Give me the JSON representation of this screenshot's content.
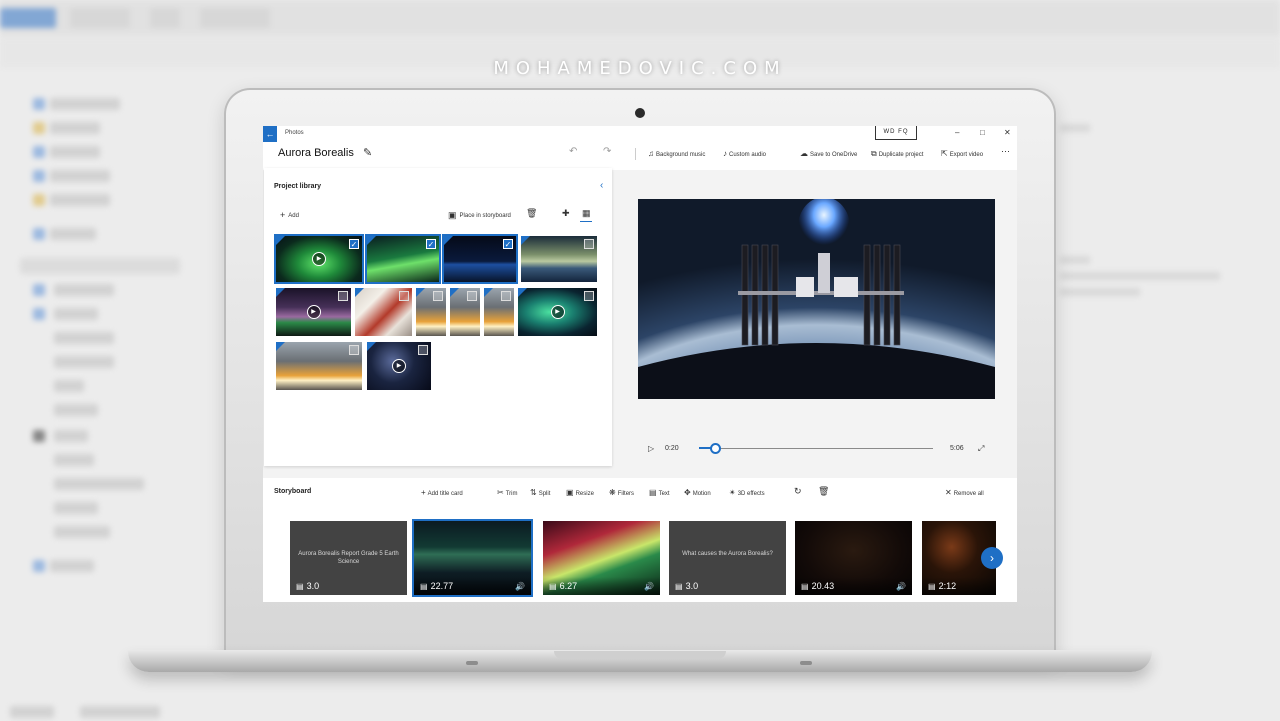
{
  "watermark": "MOHAMEDOVIC.COM",
  "window": {
    "app_name": "Photos",
    "badge": "WD FQ",
    "controls": {
      "minimize": "–",
      "maximize": "□",
      "close": "✕"
    }
  },
  "project": {
    "title": "Aurora Borealis"
  },
  "commands": {
    "background_music": "Background music",
    "custom_audio": "Custom audio",
    "save_onedrive": "Save to OneDrive",
    "duplicate_project": "Duplicate project",
    "export_video": "Export video"
  },
  "library": {
    "title": "Project library",
    "add": "Add",
    "place_in_storyboard": "Place in storyboard",
    "items": [
      {
        "theme": "aurora-green",
        "video": true,
        "selected": true
      },
      {
        "theme": "aurora-green2",
        "video": false,
        "selected": true
      },
      {
        "theme": "earth-night",
        "video": false,
        "selected": true
      },
      {
        "theme": "aurora-horizon",
        "video": false,
        "selected": false
      },
      {
        "theme": "aurora-purple",
        "video": true,
        "selected": false
      },
      {
        "theme": "interior",
        "video": false,
        "selected": false
      },
      {
        "theme": "launch",
        "video": false,
        "selected": false
      },
      {
        "theme": "launch",
        "video": false,
        "selected": false
      },
      {
        "theme": "launch",
        "video": false,
        "selected": false
      },
      {
        "theme": "aurora-teal",
        "video": true,
        "selected": false
      },
      {
        "theme": "launch",
        "video": false,
        "selected": false
      },
      {
        "theme": "stars-blue",
        "video": true,
        "selected": false
      }
    ]
  },
  "player": {
    "current_time": "0:20",
    "total_time": "5:06",
    "progress": 0.07
  },
  "storyboard": {
    "title": "Storyboard",
    "tools": {
      "add_title_card": "Add title card",
      "trim": "Trim",
      "split": "Split",
      "resize": "Resize",
      "filters": "Filters",
      "text": "Text",
      "motion": "Motion",
      "effects_3d": "3D effects",
      "remove_all": "Remove all"
    },
    "clips": [
      {
        "type": "card",
        "text": "Aurora Borealis Report Grade 5 Earth Science",
        "duration": "3.0",
        "audio": false,
        "selected": false
      },
      {
        "type": "video",
        "theme": "c-aurora-night",
        "duration": "22.77",
        "audio": true,
        "selected": true
      },
      {
        "type": "video",
        "theme": "c-aurora-red",
        "duration": "6.27",
        "audio": true,
        "selected": false
      },
      {
        "type": "card",
        "text": "What causes the Aurora Borealis?",
        "duration": "3.0",
        "audio": false,
        "selected": false
      },
      {
        "type": "video",
        "theme": "c-dark",
        "duration": "20.43",
        "audio": true,
        "selected": false
      },
      {
        "type": "video",
        "theme": "c-fire",
        "duration": "2:12",
        "audio": false,
        "selected": false
      }
    ]
  },
  "colors": {
    "accent": "#1f6fc5",
    "card_bg": "#434343"
  }
}
